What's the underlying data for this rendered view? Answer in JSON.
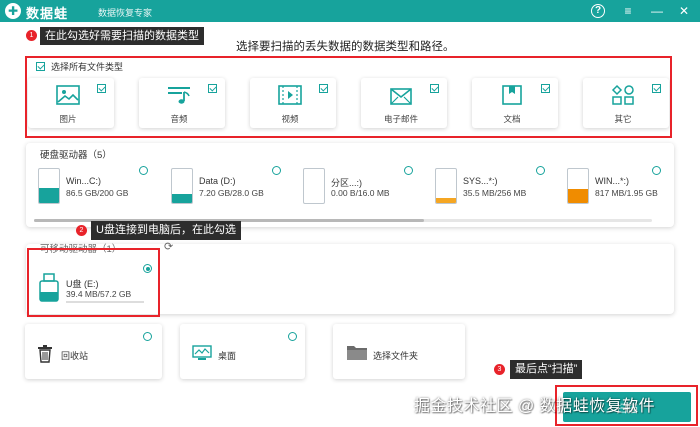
{
  "app": {
    "name": "数据蛙",
    "subtitle": "数据恢复专家"
  },
  "heading": "选择要扫描的丢失数据的数据类型和路径。",
  "callouts": [
    {
      "num": "1",
      "text": "在此勾选好需要扫描的数据类型"
    },
    {
      "num": "2",
      "text": "U盘连接到电脑后，在此勾选"
    },
    {
      "num": "3",
      "text": "最后点“扫描”"
    }
  ],
  "file_types": {
    "select_all_label": "选择所有文件类型",
    "select_all_checked": true,
    "items": [
      {
        "label": "图片",
        "icon": "image-icon",
        "checked": true
      },
      {
        "label": "音频",
        "icon": "music-icon",
        "checked": true
      },
      {
        "label": "视频",
        "icon": "video-icon",
        "checked": true
      },
      {
        "label": "电子邮件",
        "icon": "email-icon",
        "checked": true
      },
      {
        "label": "文档",
        "icon": "document-icon",
        "checked": true
      },
      {
        "label": "其它",
        "icon": "other-icon",
        "checked": true
      }
    ]
  },
  "hard_drives": {
    "title": "硬盘驱动器（5）",
    "drives": [
      {
        "name": "Win...C:)",
        "size": "86.5 GB/200 GB",
        "usage": 0.43,
        "color": "#17a39c"
      },
      {
        "name": "Data (D:)",
        "size": "7.20 GB/28.0 GB",
        "usage": 0.26,
        "color": "#17a39c"
      },
      {
        "name": "分区...:)",
        "size": "0.00  B/16.0 MB",
        "usage": 0.0,
        "color": "#17a39c"
      },
      {
        "name": "SYS...*:)",
        "size": "35.5 MB/256 MB",
        "usage": 0.14,
        "color": "#f5a623"
      },
      {
        "name": "WIN...*:)",
        "size": "817 MB/1.95 GB",
        "usage": 0.42,
        "color": "#f08c00"
      }
    ]
  },
  "removable": {
    "title": "可移动驱动器（1）",
    "drive": {
      "name": "U盘 (E:)",
      "size": "39.4 MB/57.2 GB",
      "selected": true
    }
  },
  "shortcuts": [
    {
      "label": "回收站",
      "icon": "recycle-bin-icon"
    },
    {
      "label": "桌面",
      "icon": "desktop-icon"
    },
    {
      "label": "选择文件夹",
      "icon": "folder-icon"
    }
  ],
  "scan_button": "扫描",
  "watermark": "掘金技术社区 @ 数据蛙恢复软件",
  "colors": {
    "accent": "#17a39c",
    "highlight": "#e8232a"
  }
}
